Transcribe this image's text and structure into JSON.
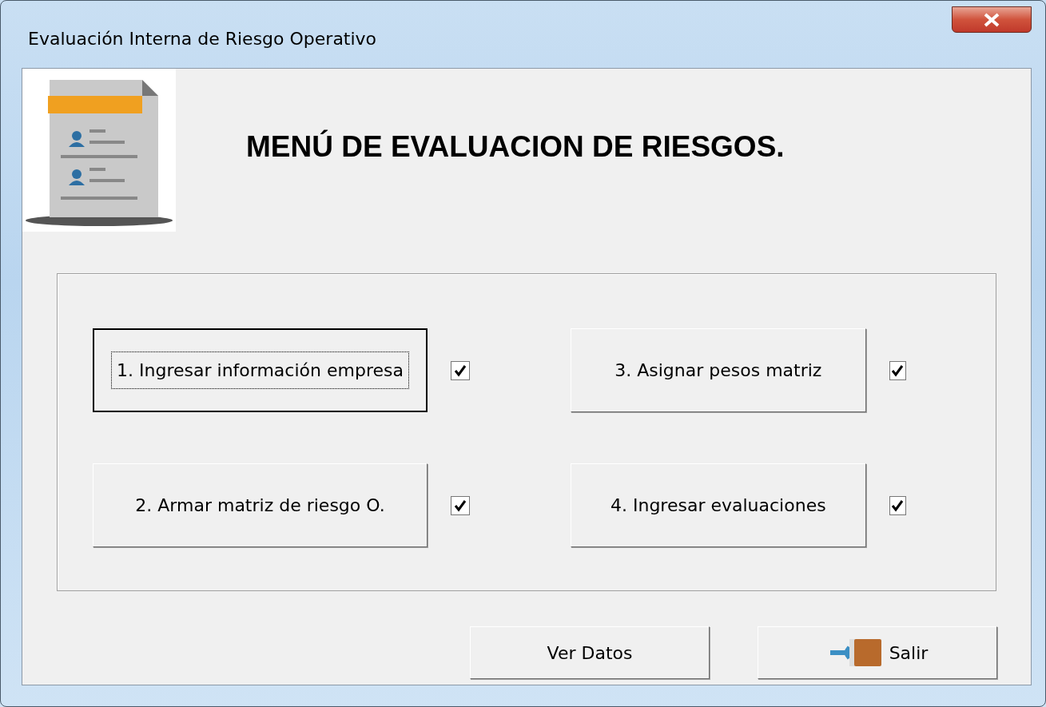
{
  "window": {
    "title": "Evaluación Interna de Riesgo Operativo"
  },
  "heading": "MENÚ DE EVALUACION DE RIESGOS.",
  "tasks": [
    {
      "label": "1. Ingresar información empresa",
      "checked": true,
      "focused": true
    },
    {
      "label": "3. Asignar pesos matriz",
      "checked": true,
      "focused": false
    },
    {
      "label": "2. Armar matriz de riesgo O.",
      "checked": true,
      "focused": false
    },
    {
      "label": "4. Ingresar evaluaciones",
      "checked": true,
      "focused": false
    }
  ],
  "footer_buttons": [
    {
      "label": "Ver Datos",
      "kind": "plain"
    },
    {
      "label": "Salir",
      "kind": "exit"
    }
  ]
}
